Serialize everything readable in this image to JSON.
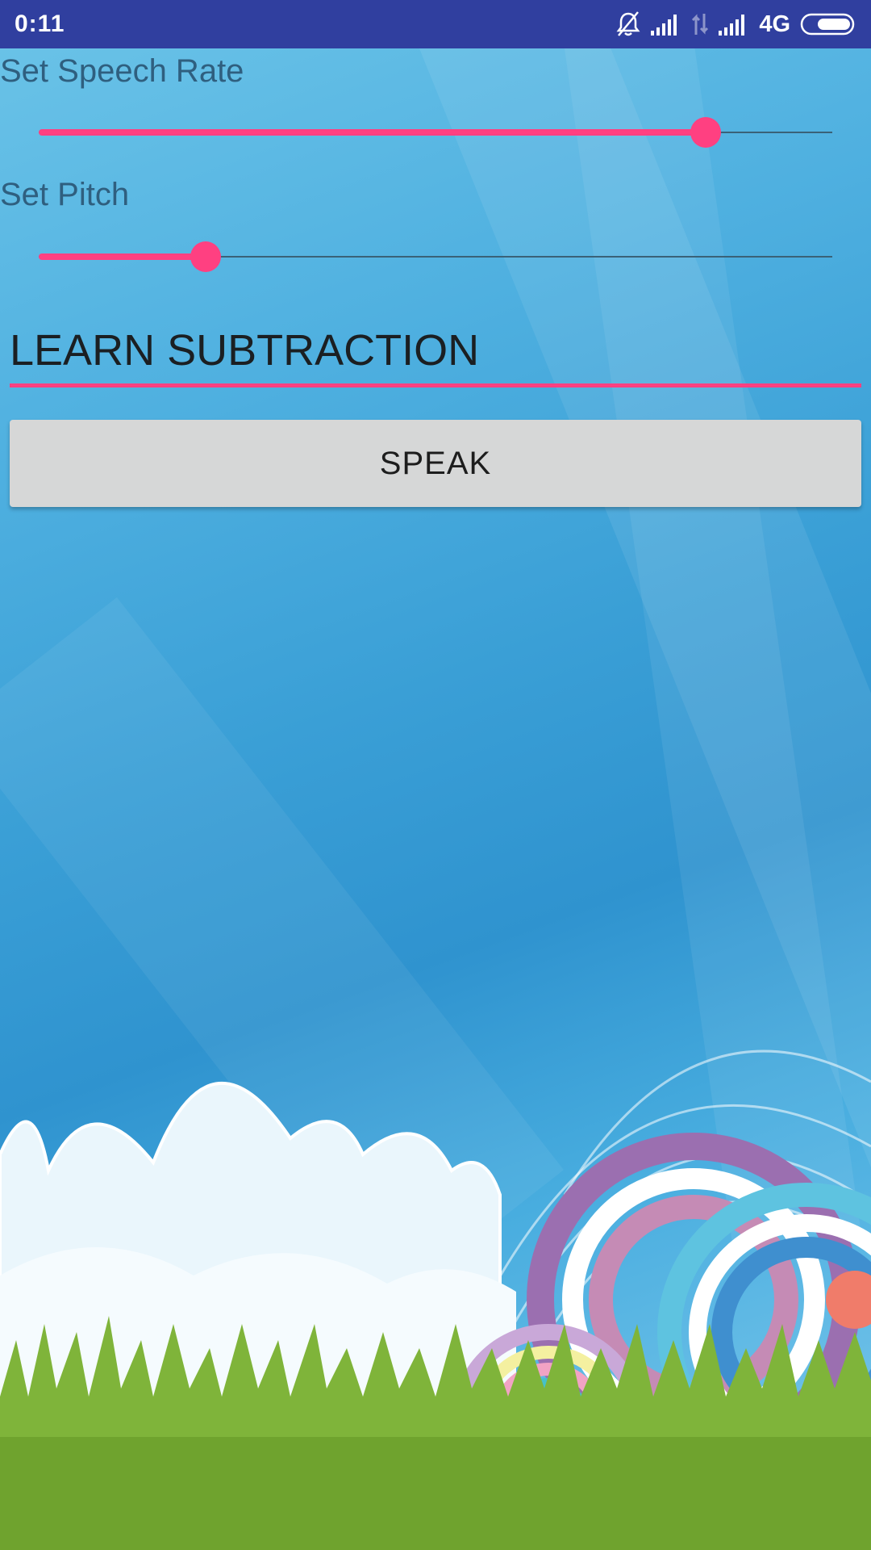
{
  "status_bar": {
    "time": "0:11",
    "network": "4G",
    "icons": [
      "bell-off-icon",
      "signal-icon",
      "data-transfer-icon",
      "signal-icon",
      "battery-icon"
    ],
    "color": "#303f9f"
  },
  "speech_rate": {
    "label": "Set Speech Rate",
    "value_fraction": 0.84
  },
  "pitch": {
    "label": "Set Pitch",
    "value_fraction": 0.21
  },
  "text_input": {
    "value": "LEARN SUBTRACTION"
  },
  "speak_button": {
    "label": "SPEAK"
  },
  "colors": {
    "accent": "#ff4081",
    "button": "#d6d7d7",
    "label_text": "#2f5f7f"
  }
}
